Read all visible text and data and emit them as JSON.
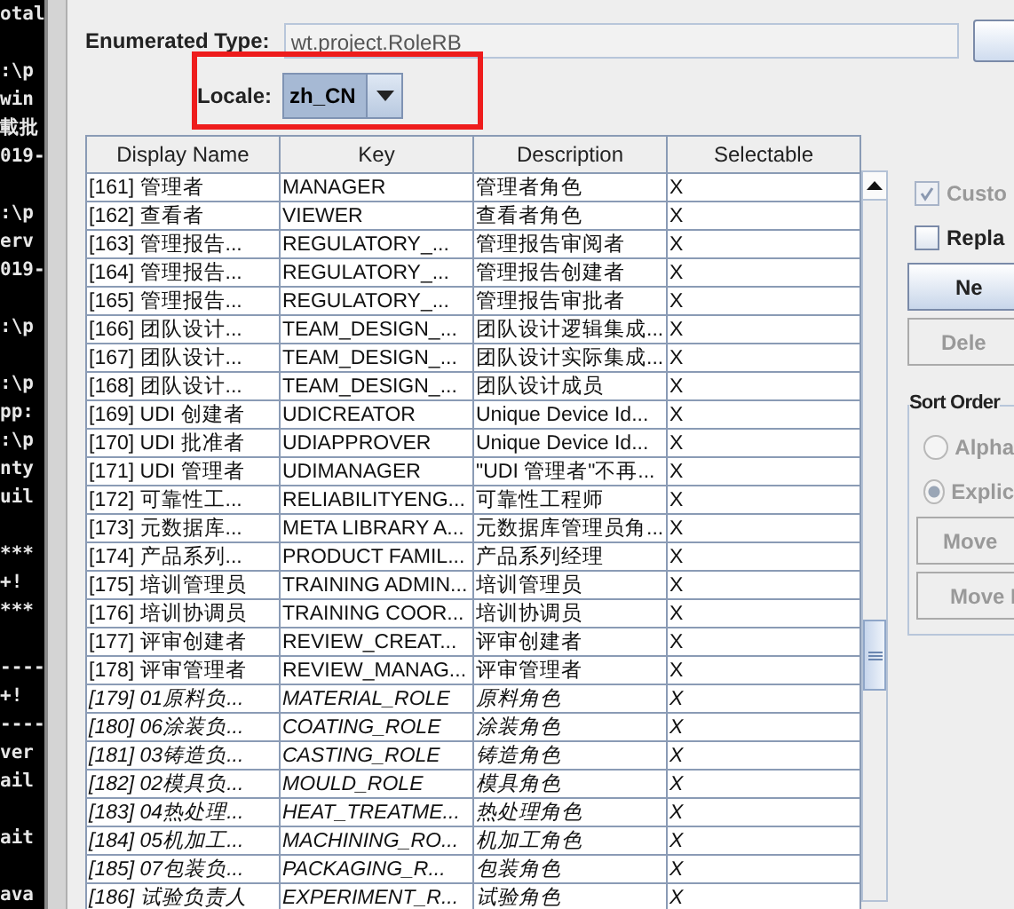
{
  "terminal": {
    "blocks": [
      [
        "otal"
      ],
      [
        ":\\p",
        "win",
        "載批",
        "019-"
      ],
      [
        ":\\p",
        "erv",
        "019-"
      ],
      [
        ":\\p"
      ],
      [
        ":\\p",
        "pp:",
        ":\\p",
        "nty",
        "uil"
      ],
      [
        "***",
        "+!",
        "***"
      ],
      [
        "----",
        "+!",
        "----",
        "ver",
        "ail"
      ],
      [
        "ait"
      ],
      [
        "ava"
      ]
    ]
  },
  "enumerated_type": {
    "label": "Enumerated Type:",
    "value": "wt.project.RoleRB"
  },
  "locale": {
    "label": "Locale:",
    "value": "zh_CN"
  },
  "table": {
    "columns": [
      "Display Name",
      "Key",
      "Description",
      "Selectable"
    ],
    "rows": [
      {
        "cells": [
          "[161] 管理者",
          "MANAGER",
          "管理者角色",
          "X"
        ],
        "italic": false
      },
      {
        "cells": [
          "[162] 查看者",
          "VIEWER",
          "查看者角色",
          "X"
        ],
        "italic": false
      },
      {
        "cells": [
          "[163] 管理报告...",
          "REGULATORY_...",
          "管理报告审阅者",
          "X"
        ],
        "italic": false
      },
      {
        "cells": [
          "[164] 管理报告...",
          "REGULATORY_...",
          "管理报告创建者",
          "X"
        ],
        "italic": false
      },
      {
        "cells": [
          "[165] 管理报告...",
          "REGULATORY_...",
          "管理报告审批者",
          "X"
        ],
        "italic": false
      },
      {
        "cells": [
          "[166] 团队设计...",
          "TEAM_DESIGN_...",
          "团队设计逻辑集成...",
          "X"
        ],
        "italic": false
      },
      {
        "cells": [
          "[167] 团队设计...",
          "TEAM_DESIGN_...",
          "团队设计实际集成...",
          "X"
        ],
        "italic": false
      },
      {
        "cells": [
          "[168] 团队设计...",
          "TEAM_DESIGN_...",
          "团队设计成员",
          "X"
        ],
        "italic": false
      },
      {
        "cells": [
          "[169] UDI 创建者",
          "UDICREATOR",
          "Unique Device Id...",
          "X"
        ],
        "italic": false
      },
      {
        "cells": [
          "[170] UDI 批准者",
          "UDIAPPROVER",
          "Unique Device Id...",
          "X"
        ],
        "italic": false
      },
      {
        "cells": [
          "[171] UDI 管理者",
          "UDIMANAGER",
          "\"UDI 管理者\"不再...",
          "X"
        ],
        "italic": false
      },
      {
        "cells": [
          "[172] 可靠性工...",
          "RELIABILITYENG...",
          "可靠性工程师",
          "X"
        ],
        "italic": false
      },
      {
        "cells": [
          "[173] 元数据库...",
          "META LIBRARY A...",
          "元数据库管理员角...",
          "X"
        ],
        "italic": false
      },
      {
        "cells": [
          "[174] 产品系列...",
          "PRODUCT FAMIL...",
          "产品系列经理",
          "X"
        ],
        "italic": false
      },
      {
        "cells": [
          "[175] 培训管理员",
          "TRAINING ADMIN...",
          "培训管理员",
          "X"
        ],
        "italic": false
      },
      {
        "cells": [
          "[176] 培训协调员",
          "TRAINING COOR...",
          "培训协调员",
          "X"
        ],
        "italic": false
      },
      {
        "cells": [
          "[177] 评审创建者",
          "REVIEW_CREAT...",
          "评审创建者",
          "X"
        ],
        "italic": false
      },
      {
        "cells": [
          "[178] 评审管理者",
          "REVIEW_MANAG...",
          "评审管理者",
          "X"
        ],
        "italic": false
      },
      {
        "cells": [
          "[179] 01原料负...",
          "MATERIAL_ROLE",
          "原料角色",
          "X"
        ],
        "italic": true
      },
      {
        "cells": [
          "[180] 06涂装负...",
          "COATING_ROLE",
          "涂装角色",
          "X"
        ],
        "italic": true
      },
      {
        "cells": [
          "[181] 03铸造负...",
          "CASTING_ROLE",
          "铸造角色",
          "X"
        ],
        "italic": true
      },
      {
        "cells": [
          "[182] 02模具负...",
          "MOULD_ROLE",
          "模具角色",
          "X"
        ],
        "italic": true
      },
      {
        "cells": [
          "[183] 04热处理...",
          "HEAT_TREATME...",
          "热处理角色",
          "X"
        ],
        "italic": true
      },
      {
        "cells": [
          "[184] 05机加工...",
          "MACHINING_RO...",
          "机加工角色",
          "X"
        ],
        "italic": true
      },
      {
        "cells": [
          "[185] 07包装负...",
          "PACKAGING_R...",
          "包装角色",
          "X"
        ],
        "italic": true
      },
      {
        "cells": [
          "[186] 试验负责人",
          "EXPERIMENT_R...",
          "试验角色",
          "X"
        ],
        "italic": true
      }
    ]
  },
  "options": [
    {
      "label": "Custo",
      "checked": true,
      "disabled": true
    },
    {
      "label": "Repla",
      "checked": false,
      "disabled": false
    }
  ],
  "buttons": [
    {
      "label": "Ne",
      "disabled": false
    },
    {
      "label": "Dele",
      "disabled": true
    }
  ],
  "sort_order": {
    "title": "Sort Order",
    "radios": [
      {
        "label": "Alpha",
        "selected": false,
        "disabled": true
      },
      {
        "label": "Explic",
        "selected": true,
        "disabled": true
      }
    ],
    "buttons": [
      {
        "label": "Move",
        "disabled": true
      },
      {
        "label": "Move I",
        "disabled": true
      }
    ]
  }
}
